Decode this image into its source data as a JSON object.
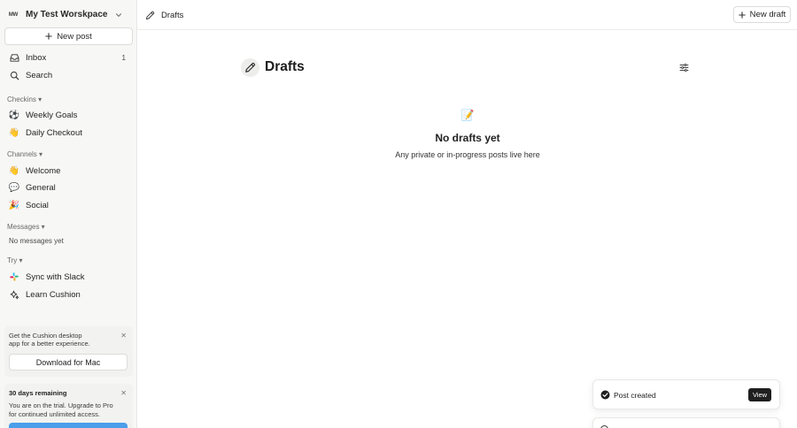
{
  "sidebar": {
    "workspace": {
      "initials": "MW",
      "name": "My Test Worskpace"
    },
    "new_post_label": "New post",
    "primary": [
      {
        "icon": "inbox-icon",
        "label": "Inbox",
        "count": "1"
      },
      {
        "icon": "search-icon",
        "label": "Search"
      }
    ],
    "sections": {
      "checkins": {
        "label": "Checkins ▾",
        "items": [
          {
            "emoji": "⚽",
            "label": "Weekly Goals"
          },
          {
            "emoji": "👋",
            "label": "Daily Checkout"
          }
        ]
      },
      "channels": {
        "label": "Channels ▾",
        "items": [
          {
            "emoji": "👋",
            "label": "Welcome"
          },
          {
            "emoji": "💬",
            "label": "General"
          },
          {
            "emoji": "🎉",
            "label": "Social"
          }
        ]
      },
      "messages": {
        "label": "Messages ▾",
        "empty": "No messages yet"
      },
      "try": {
        "label": "Try ▾",
        "items": [
          {
            "icon": "slack-icon",
            "label": "Sync with Slack"
          },
          {
            "icon": "sparkle-icon",
            "label": "Learn Cushion"
          }
        ]
      }
    },
    "desktop_card": {
      "line1": "Get the Cushion desktop",
      "line2": "app for a better experience.",
      "button": "Download for Mac",
      "close": "✕"
    },
    "trial_card": {
      "title": "30 days remaining",
      "line1": "You are on the trial. Upgrade to Pro",
      "line2": "for continued unlimited access.",
      "close": "✕"
    }
  },
  "topbar": {
    "title": "Drafts",
    "new_draft_label": "New draft"
  },
  "main": {
    "title": "Drafts",
    "empty_emoji": "📝",
    "empty_title": "No drafts yet",
    "empty_subtitle": "Any private or in-progress posts live here"
  },
  "toast": {
    "message": "Post created",
    "action": "View"
  },
  "colors": {
    "sidebar_bg": "#f7f7f6",
    "accent_blue": "#4a9eea",
    "toast_button": "#1f1f1f"
  }
}
